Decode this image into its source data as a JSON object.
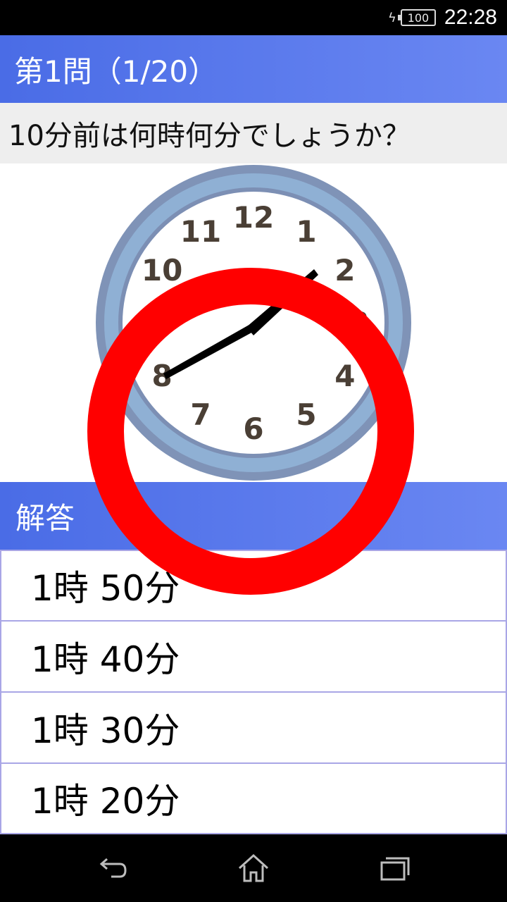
{
  "status_bar": {
    "battery_level": "100",
    "time": "22:28",
    "icons": [
      "charging-icon",
      "battery-icon"
    ]
  },
  "header": {
    "title": "第1問（1/20）"
  },
  "question": {
    "text": "10分前は何時何分でしょうか？"
  },
  "clock": {
    "numbers": [
      "12",
      "1",
      "2",
      "3",
      "4",
      "5",
      "6",
      "7",
      "8",
      "9",
      "10",
      "11"
    ],
    "shown_time": {
      "hour": 1,
      "minute": 40
    },
    "face_color": "#ffffff",
    "rim_color": "#8aa7c9",
    "numeral_color": "#4a3f35"
  },
  "answer_section": {
    "title": "解答",
    "options": [
      "1時 50分",
      "1時 40分",
      "1時 30分",
      "1時 20分"
    ]
  },
  "result_mark": {
    "type": "correct-circle",
    "color": "#ff0000"
  },
  "nav_bar": {
    "icons": [
      "back-icon",
      "home-icon",
      "recent-apps-icon"
    ]
  },
  "colors": {
    "header_start": "#4a6ce6",
    "header_end": "#6a87f2",
    "option_border": "#a9a6e6"
  }
}
